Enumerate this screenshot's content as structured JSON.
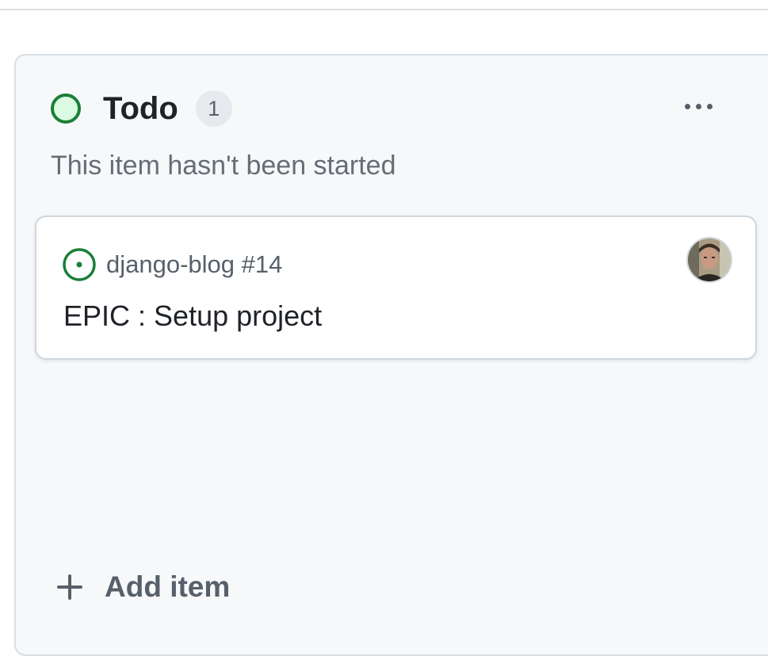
{
  "column": {
    "title": "Todo",
    "count": "1",
    "description": "This item hasn't been started",
    "status_color": "#1a7f37",
    "status_fill": "#dafbe1",
    "more_icon": "kebab-horizontal-icon"
  },
  "cards": [
    {
      "repo_ref": "django-blog #14",
      "title": "EPIC : Setup project",
      "state_icon": "issue-opened-icon",
      "state_color": "#1a7f37",
      "assignee_icon": "avatar"
    }
  ],
  "footer": {
    "add_label": "Add item",
    "add_icon": "plus-icon"
  }
}
